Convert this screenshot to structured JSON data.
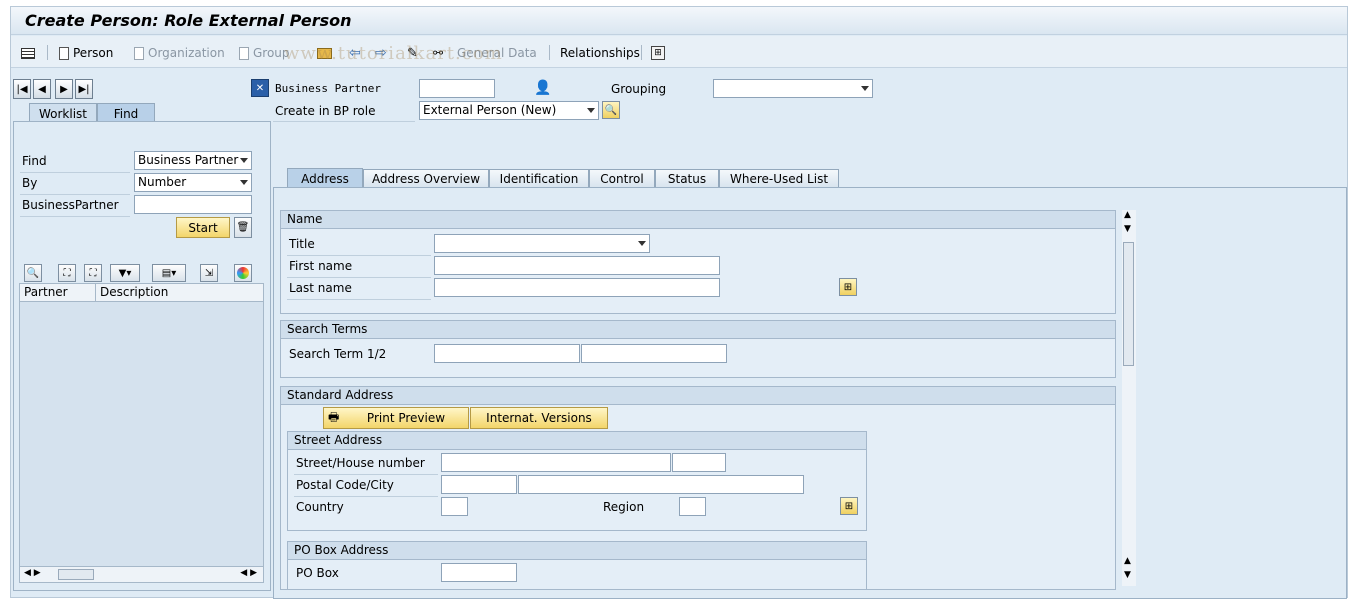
{
  "window": {
    "title": "Create Person: Role External Person"
  },
  "toolbar": {
    "person": "Person",
    "organization": "Organization",
    "group": "Group",
    "general_data": "General Data",
    "relationships": "Relationships"
  },
  "watermark": "www.tutorialkart.com",
  "left": {
    "tabs": [
      "Worklist",
      "Find"
    ],
    "find_label": "Find",
    "find_value": "Business Partner",
    "by_label": "By",
    "by_value": "Number",
    "bp_label": "BusinessPartner",
    "bp_value": "",
    "start_label": "Start",
    "columns": [
      "Partner",
      "Description"
    ]
  },
  "header": {
    "bp_label": "Business Partner",
    "bp_value": "",
    "grouping_label": "Grouping",
    "grouping_value": "",
    "role_label": "Create in BP role",
    "role_value": "External Person (New)"
  },
  "tabs": [
    "Address",
    "Address Overview",
    "Identification",
    "Control",
    "Status",
    "Where-Used List"
  ],
  "name_group": {
    "title": "Name",
    "title_label": "Title",
    "first_label": "First name",
    "last_label": "Last name"
  },
  "search_group": {
    "title": "Search Terms",
    "term_label": "Search Term 1/2"
  },
  "address_group": {
    "title": "Standard Address",
    "print_preview": "Print Preview",
    "intl_versions": "Internat. Versions",
    "street_title": "Street Address",
    "street_label": "Street/House number",
    "postal_label": "Postal Code/City",
    "country_label": "Country",
    "region_label": "Region",
    "pobox_title": "PO Box Address",
    "pobox_label": "PO Box"
  }
}
